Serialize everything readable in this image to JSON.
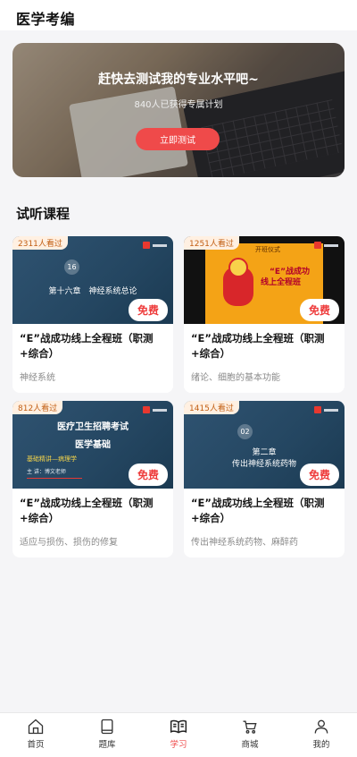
{
  "header": {
    "title": "医学考编"
  },
  "banner": {
    "headline": "赶快去测试我的专业水平吧~",
    "subtitle": "840人已获得专属计划",
    "button_label": "立即测试"
  },
  "section": {
    "title": "试听课程"
  },
  "courses": [
    {
      "views": "2311人看过",
      "thumb_number": "16",
      "thumb_line1": "第十六章　神经系统总论",
      "free_label": "免费",
      "title": "“E”战成功线上全程班（职测+综合）",
      "desc": "神经系统"
    },
    {
      "views": "1251人看过",
      "thumb_sub": "开班仪式",
      "thumb_line1": "“E”战成功",
      "thumb_line2": "线上全程班",
      "free_label": "免费",
      "title": "“E”战成功线上全程班（职测+综合）",
      "desc": "绪论、细胞的基本功能"
    },
    {
      "views": "812人看过",
      "thumb_line1": "医疗卫生招聘考试",
      "thumb_line2": "医学基础",
      "thumb_line3": "基础精讲—病理学",
      "thumb_line4": "主  讲：博文老师",
      "free_label": "免费",
      "title": "“E”战成功线上全程班（职测+综合）",
      "desc": "适应与损伤、损伤的修复"
    },
    {
      "views": "1415人看过",
      "thumb_number": "02",
      "thumb_line1": "第二章",
      "thumb_line2": "传出神经系统药物",
      "free_label": "免费",
      "title": "“E”战成功线上全程班（职测+综合）",
      "desc": "传出神经系统药物、麻醉药"
    }
  ],
  "tabbar": [
    {
      "label": "首页",
      "icon": "home-icon",
      "active": false
    },
    {
      "label": "题库",
      "icon": "book-icon",
      "active": false
    },
    {
      "label": "学习",
      "icon": "open-book-icon",
      "active": true
    },
    {
      "label": "商城",
      "icon": "cart-icon",
      "active": false
    },
    {
      "label": "我的",
      "icon": "person-icon",
      "active": false
    }
  ],
  "colors": {
    "accent": "#ef4a4a",
    "badge_text": "#c25f14",
    "thumb_blue": "#2f5371"
  }
}
